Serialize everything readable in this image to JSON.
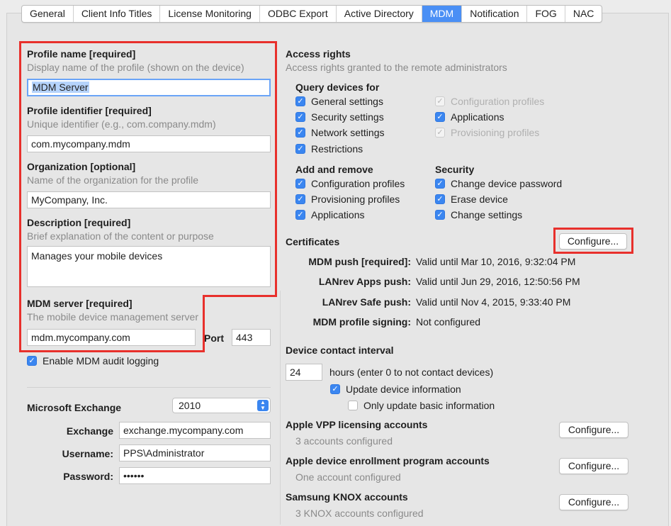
{
  "tabs": [
    "General",
    "Client Info Titles",
    "License Monitoring",
    "ODBC Export",
    "Active Directory",
    "MDM",
    "Notification",
    "FOG",
    "NAC"
  ],
  "profile": {
    "name_label": "Profile name [required]",
    "name_sub": "Display name of the profile (shown on the device)",
    "name_value": "MDM Server",
    "identifier_label": "Profile identifier [required]",
    "identifier_sub": "Unique identifier (e.g., com.company.mdm)",
    "identifier_value": "com.mycompany.mdm",
    "org_label": "Organization [optional]",
    "org_sub": "Name of the organization for the profile",
    "org_value": "MyCompany, Inc.",
    "desc_label": "Description [required]",
    "desc_sub": "Brief explanation of the content or purpose",
    "desc_value": "Manages your mobile devices",
    "server_label": "MDM server [required]",
    "server_sub": "The mobile device management server",
    "server_value": "mdm.mycompany.com",
    "port_label": "Port",
    "port_value": "443",
    "audit_label": "Enable MDM audit logging"
  },
  "exchange": {
    "title": "Microsoft Exchange",
    "version": "2010",
    "exchange_label": "Exchange",
    "exchange_value": "exchange.mycompany.com",
    "username_label": "Username:",
    "username_value": "PPS\\Administrator",
    "password_label": "Password:",
    "password_value": "••••••"
  },
  "access": {
    "title": "Access rights",
    "sub": "Access rights granted to the remote administrators",
    "query_title": "Query devices for",
    "query_items": [
      "General settings",
      "Security settings",
      "Network settings",
      "Restrictions"
    ],
    "query_items_right": [
      "Configuration profiles",
      "Applications",
      "Provisioning profiles"
    ],
    "add_title": "Add and remove",
    "add_items": [
      "Configuration profiles",
      "Provisioning profiles",
      "Applications"
    ],
    "security_title": "Security",
    "security_items": [
      "Change device password",
      "Erase device",
      "Change settings"
    ]
  },
  "certificates": {
    "title": "Certificates",
    "configure": "Configure...",
    "rows": [
      {
        "label": "MDM push [required]:",
        "value": "Valid until Mar 10, 2016, 9:32:04 PM"
      },
      {
        "label": "LANrev Apps push:",
        "value": "Valid until Jun 29, 2016, 12:50:56 PM"
      },
      {
        "label": "LANrev Safe push:",
        "value": "Valid until Nov 4, 2015, 9:33:40 PM"
      },
      {
        "label": "MDM profile signing:",
        "value": "Not configured"
      }
    ]
  },
  "contact": {
    "title": "Device contact interval",
    "hours_value": "24",
    "hours_label": "hours (enter 0 to not contact devices)",
    "update_label": "Update device information",
    "only_basic_label": "Only update basic information"
  },
  "vpp": {
    "title": "Apple VPP licensing accounts",
    "sub": "3 accounts configured",
    "configure": "Configure..."
  },
  "dep": {
    "title": "Apple device enrollment program accounts",
    "sub": "One account configured",
    "configure": "Configure..."
  },
  "knox": {
    "title": "Samsung KNOX accounts",
    "sub": "3 KNOX accounts configured",
    "configure": "Configure..."
  },
  "colors": {
    "accent": "#3b86f0",
    "highlight": "#e8302c"
  }
}
